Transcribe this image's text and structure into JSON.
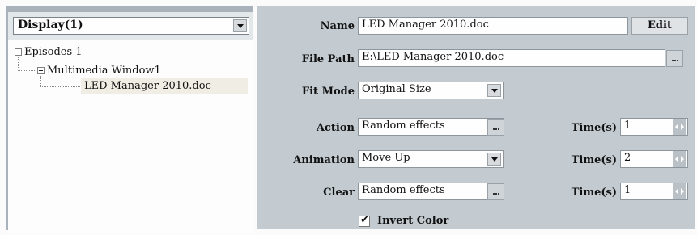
{
  "left_pane": {
    "display_select": {
      "value": "Display(1)"
    },
    "tree": [
      {
        "label": "Episodes 1",
        "level": 0,
        "expanded": true
      },
      {
        "label": "Multimedia Window1",
        "level": 1,
        "expanded": true
      },
      {
        "label": "LED Manager 2010.doc",
        "level": 2,
        "selected": true
      }
    ]
  },
  "properties": {
    "name": {
      "label": "Name",
      "value": "LED Manager 2010.doc",
      "edit_button": "Edit"
    },
    "file_path": {
      "label": "File Path",
      "value": "E:\\LED Manager 2010.doc"
    },
    "fit_mode": {
      "label": "Fit Mode",
      "value": "Original Size"
    },
    "action": {
      "label": "Action",
      "value": "Random effects",
      "time_label": "Time(s)",
      "time_value": "1"
    },
    "animation": {
      "label": "Animation",
      "value": "Move Up",
      "time_label": "Time(s)",
      "time_value": "2"
    },
    "clear": {
      "label": "Clear",
      "value": "Random effects",
      "time_label": "Time(s)",
      "time_value": "1"
    },
    "invert_color": {
      "label": "Invert Color",
      "checked": true
    }
  },
  "icons": {
    "dropdown": "chevron-down-icon",
    "ellipsis": "ellipsis-icon",
    "spinner": "spinner-arrows-icon",
    "expander": "minus-box-icon",
    "check": "checkmark-icon"
  },
  "colors": {
    "left_border": "#a9b2bb",
    "right_panel": "#c3cbd1",
    "selection": "#f0eee4"
  }
}
